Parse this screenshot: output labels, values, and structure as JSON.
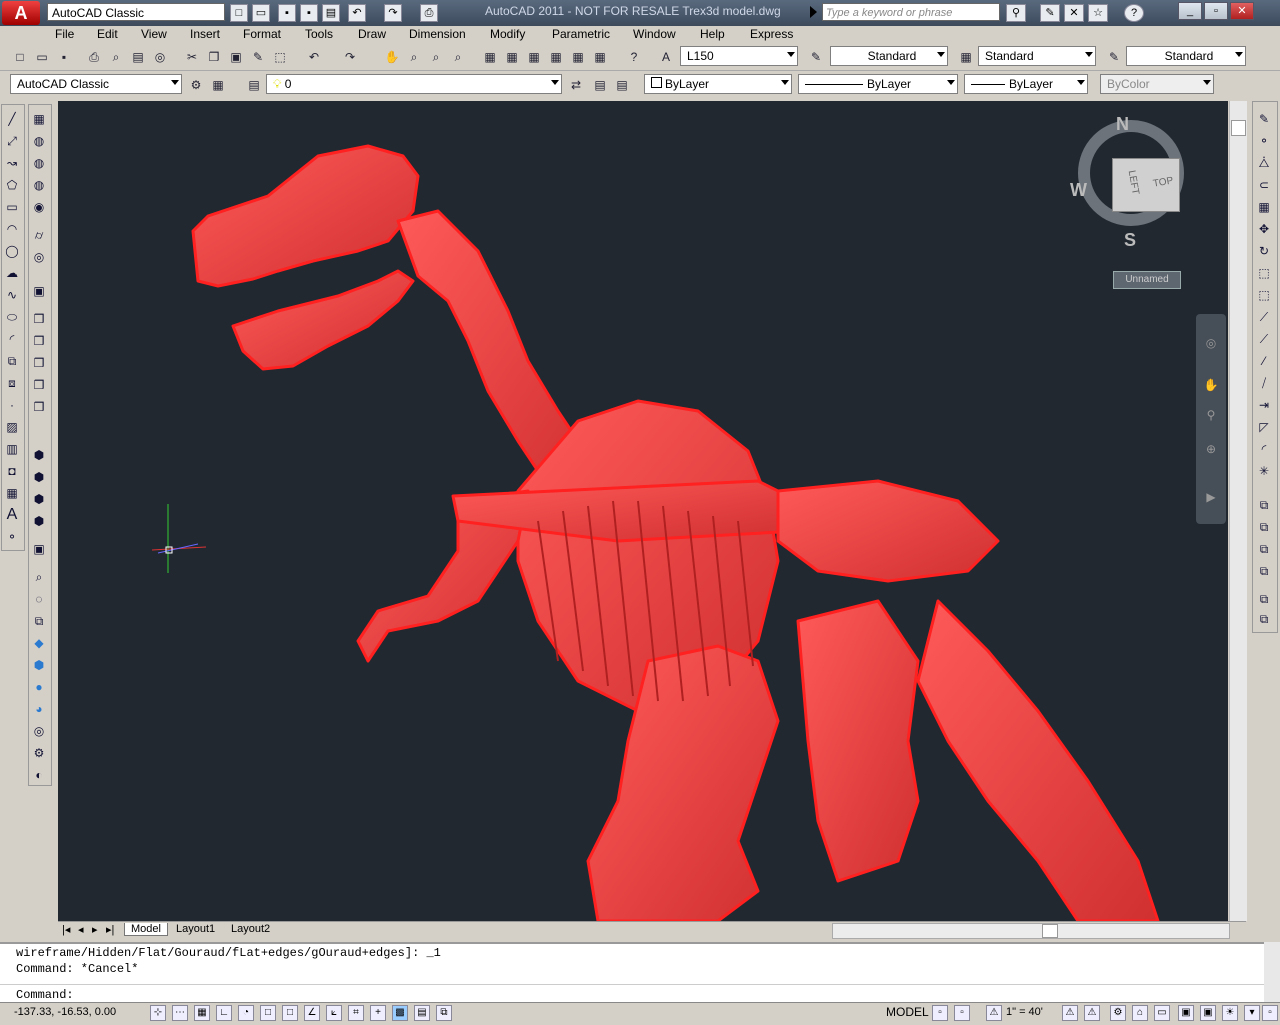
{
  "titlebar": {
    "app_button_label": "A",
    "workspace": "AutoCAD Classic",
    "title": "AutoCAD 2011 - NOT FOR RESALE    Trex3d model.dwg",
    "search_placeholder": "Type a keyword or phrase",
    "help_label": "?"
  },
  "menu": [
    "File",
    "Edit",
    "View",
    "Insert",
    "Format",
    "Tools",
    "Draw",
    "Dimension",
    "Modify",
    "Parametric",
    "Window",
    "Help",
    "Express"
  ],
  "toolbar1": {
    "dimstyle": "L150",
    "textstyle": "Standard",
    "tablestyle": "Standard",
    "mleaderstyle": "Standard"
  },
  "toolbar2": {
    "workspace": "AutoCAD Classic",
    "layer": "0",
    "color": "ByLayer",
    "linetype": "ByLayer",
    "lineweight": "ByLayer",
    "plotstyle": "ByColor"
  },
  "viewcube": {
    "north": "N",
    "south": "S",
    "west": "W",
    "left_face": "LEFT",
    "top_face": "TOP",
    "ucs_menu": "Unnamed"
  },
  "tabs": [
    "Model",
    "Layout1",
    "Layout2"
  ],
  "command": {
    "history1": "wireframe/Hidden/Flat/Gouraud/fLat+edges/gOuraud+edges]: _1",
    "history2": "Command: *Cancel*",
    "prompt": "Command:"
  },
  "status": {
    "coords": "-137.33, -16.53, 0.00",
    "model": "MODEL",
    "scale": "1\" = 40'"
  },
  "colors": {
    "model_red": "#ff3b3b",
    "background": "#212830"
  }
}
